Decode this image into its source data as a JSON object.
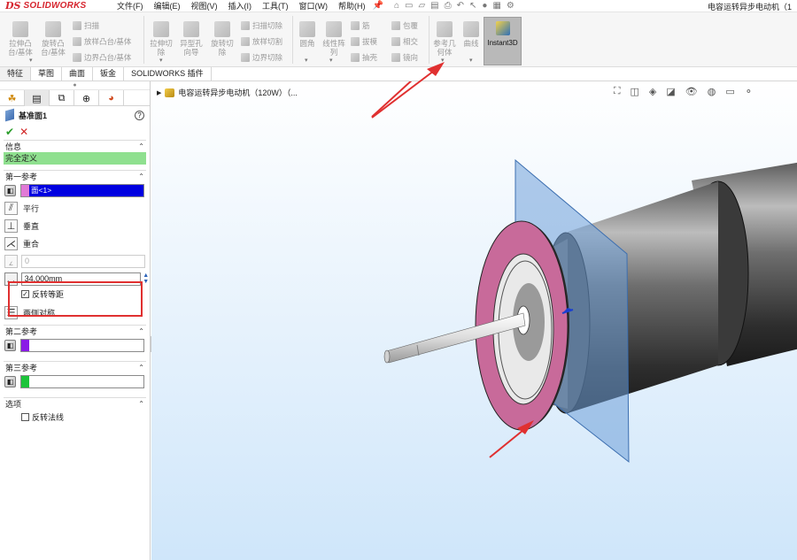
{
  "app": {
    "logo_ds": "DS",
    "logo_name": "SOLIDWORKS",
    "menus": [
      "文件(F)",
      "编辑(E)",
      "视图(V)",
      "插入(I)",
      "工具(T)",
      "窗口(W)",
      "帮助(H)"
    ],
    "doc_title": "电容运转异步电动机（1"
  },
  "ribbon": {
    "extrude_boss": "拉伸凸\n台/基体",
    "revolve_boss": "旋转凸\n台/基体",
    "sweep": "扫描",
    "loft_boss": "放样凸台/基体",
    "boundary_boss": "边界凸台/基体",
    "extrude_cut": "拉伸切\n除",
    "hole_wizard": "异型孔\n向导",
    "revolve_cut": "旋转切\n除",
    "swept_cut": "扫描切除",
    "lofted_cut": "放样切割",
    "boundary_cut": "边界切除",
    "fillet": "圆角",
    "linear_pattern": "线性阵\n列",
    "rib": "筋",
    "draft": "拔模",
    "shell": "抽壳",
    "wrap": "包覆",
    "intersect": "相交",
    "mirror": "镜向",
    "ref_geometry": "参考几\n何体",
    "curves": "曲线",
    "instant3d": "Instant3D"
  },
  "cmd_tabs": [
    "特征",
    "草图",
    "曲面",
    "钣金",
    "SOLIDWORKS 插件"
  ],
  "panel": {
    "title": "基准面1",
    "help": "?",
    "ok": "✔",
    "cancel": "✕",
    "info_header": "信息",
    "status": "完全定义",
    "first_ref_header": "第一参考",
    "first_ref_value": "面<1>",
    "opt_parallel": "平行",
    "opt_perpendicular": "垂直",
    "opt_coincident": "重合",
    "angle_value": "0",
    "distance_value": "34.000mm",
    "flip_offset": "反转等距",
    "opt_mid_plane": "两侧对称",
    "second_ref_header": "第二参考",
    "third_ref_header": "第三参考",
    "options_header": "选项",
    "flip_normal": "反转法线"
  },
  "viewport": {
    "tree_item": "电容运转异步电动机（120W）（..."
  },
  "colors": {
    "first_ref_swatch": "#e17ad6",
    "second_ref_swatch": "#8a1ae6",
    "third_ref_swatch": "#1cc43a",
    "status_green": "#8fe08f",
    "plane_fill": "#6fa0d8",
    "flange_pink": "#c86a9a",
    "annotation_red": "#e03030"
  }
}
